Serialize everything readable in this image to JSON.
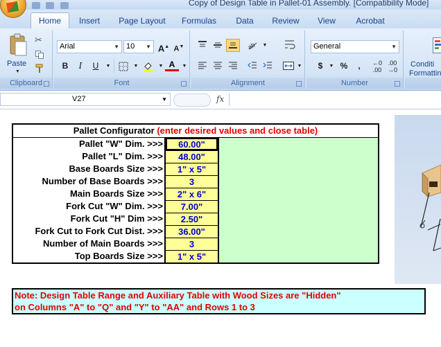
{
  "window": {
    "title": "Copy of Design Table in Pallet-01 Assembly.  [Compatibility Mode]"
  },
  "tabs": [
    {
      "label": "Home",
      "active": true
    },
    {
      "label": "Insert"
    },
    {
      "label": "Page Layout"
    },
    {
      "label": "Formulas"
    },
    {
      "label": "Data"
    },
    {
      "label": "Review"
    },
    {
      "label": "View"
    },
    {
      "label": "Acrobat"
    }
  ],
  "ribbon": {
    "clipboard": {
      "paste_label": "Paste",
      "group_label": "Clipboard"
    },
    "font": {
      "font_name": "Arial",
      "font_size": "10",
      "group_label": "Font"
    },
    "alignment": {
      "group_label": "Alignment"
    },
    "number": {
      "format": "General",
      "group_label": "Number",
      "currency": "$",
      "percent": "%",
      "comma": ","
    },
    "styles": {
      "conditional_line1": "Conditi",
      "conditional_line2": "Formattin"
    }
  },
  "formula_bar": {
    "cell_ref": "V27",
    "fx": "fx",
    "content": ""
  },
  "configurator": {
    "title_black": "Pallet Configurator ",
    "title_red": "(enter desired values and close table)",
    "rows": [
      {
        "label": "Pallet \"W\" Dim. >>>",
        "value": "60.00\""
      },
      {
        "label": "Pallet \"L\" Dim. >>>",
        "value": "48.00\""
      },
      {
        "label": "Base Boards Size >>>",
        "value": "1\" x 5\""
      },
      {
        "label": "Number of Base Boards >>>",
        "value": "3"
      },
      {
        "label": "Main Boards Size >>>",
        "value": "2\" x 6\""
      },
      {
        "label": "Fork Cut \"W\" Dim. >>>",
        "value": "7.00\""
      },
      {
        "label": "Fork Cut \"H\" Dim >>>",
        "value": "2.50\""
      },
      {
        "label": "Fork Cut to Fork Cut Dist. >>>",
        "value": "36.00\""
      },
      {
        "label": "Number of Main Boards >>>",
        "value": "3"
      },
      {
        "label": "Top Boards Size >>>",
        "value": "1\" x 5\""
      }
    ]
  },
  "note": {
    "line1": "Note: Design Table Range and Auxiliary Table with Wood Sizes are \"Hidden\"",
    "line2": "on Columns \"A\" to \"Q\" and \"Y\"  to \"AA\" and Rows 1 to 3"
  },
  "colors": {
    "accent_red": "#e00000",
    "value_blue": "#0000cc",
    "value_fill": "#ffff99",
    "green_area": "#ccffcc",
    "note_fill": "#ccffff"
  }
}
